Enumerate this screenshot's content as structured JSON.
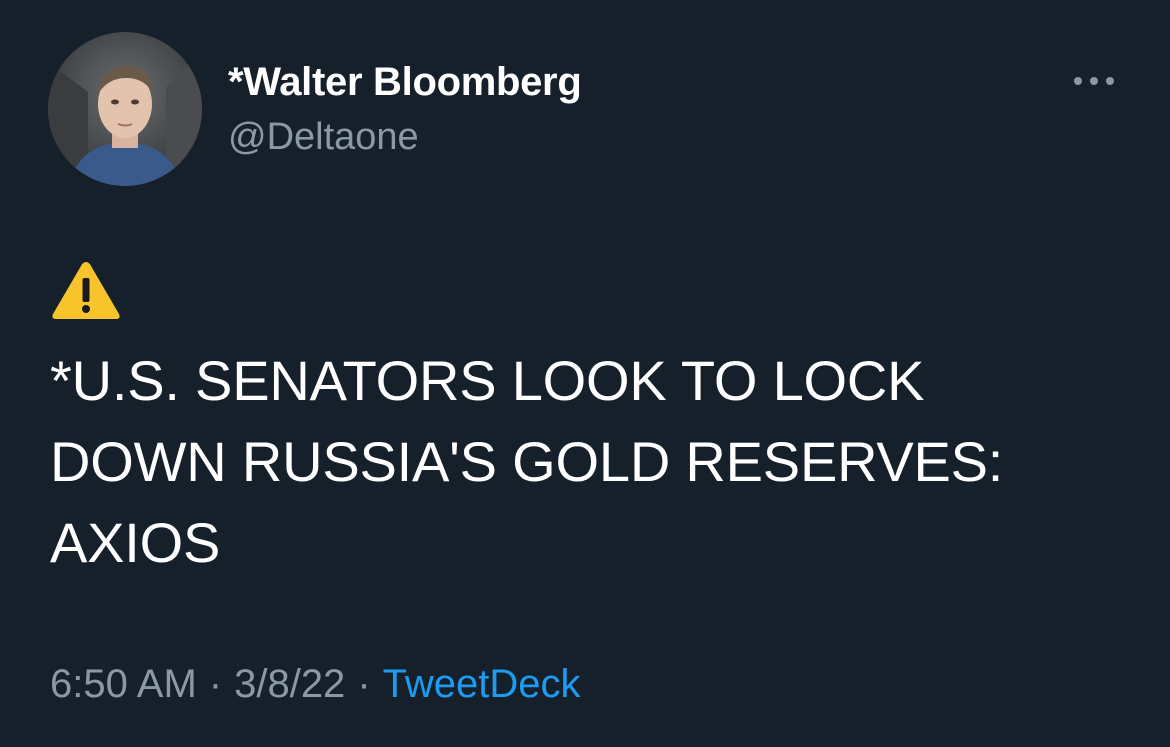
{
  "author": {
    "display_name": "*Walter Bloomberg",
    "handle": "@Deltaone",
    "avatar_icon": "profile-photo"
  },
  "more_menu_icon": "more-horizontal-icon",
  "tweet": {
    "emoji_icon": "warning-icon",
    "text_lines": [
      "*U.S. SENATORS LOOK TO LOCK",
      "DOWN RUSSIA'S GOLD RESERVES:",
      "AXIOS"
    ]
  },
  "meta": {
    "time": "6:50 AM",
    "separator": "·",
    "date": "3/8/22",
    "source": "TweetDeck"
  },
  "colors": {
    "background": "#15202b",
    "primary_text": "#ffffff",
    "secondary_text": "#8b98a5",
    "link": "#1d9bf0",
    "warning_yellow": "#f7c52b"
  }
}
